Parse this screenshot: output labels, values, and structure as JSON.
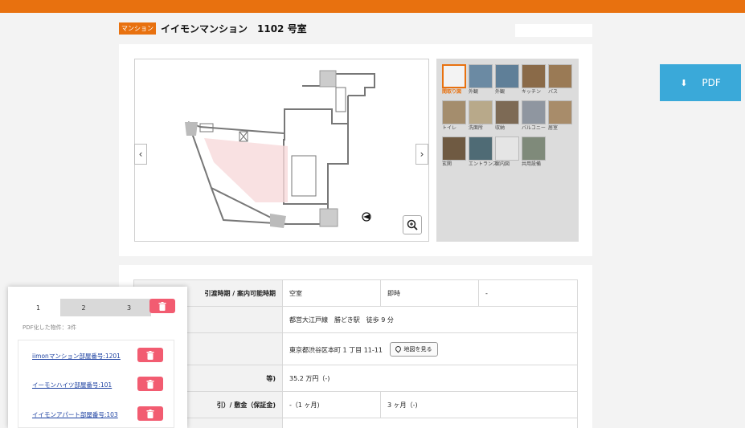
{
  "header": {
    "type_badge": "マンション",
    "title": "イイモンマンション　1102 号室"
  },
  "floorplan": {
    "prev_icon": "chevron-left-icon",
    "next_icon": "chevron-right-icon",
    "zoom_icon": "zoom-in-icon"
  },
  "thumbnails": [
    {
      "label": "間取り図",
      "color": "#f3f3f3"
    },
    {
      "label": "外観",
      "color": "#6b8aa3"
    },
    {
      "label": "外観",
      "color": "#5f7f98"
    },
    {
      "label": "キッチン",
      "color": "#8a6a48"
    },
    {
      "label": "バス",
      "color": "#9a7a55"
    },
    {
      "label": "トイレ",
      "color": "#a48d6d"
    },
    {
      "label": "洗面所",
      "color": "#b8a98a"
    },
    {
      "label": "収納",
      "color": "#7d6a55"
    },
    {
      "label": "バルコニー",
      "color": "#8f96a0"
    },
    {
      "label": "居室",
      "color": "#a88c6a"
    },
    {
      "label": "玄関",
      "color": "#6f5a42"
    },
    {
      "label": "エントランス",
      "color": "#4f6b75"
    },
    {
      "label": "案内図",
      "color": "#e5e5e5"
    },
    {
      "label": "共用設備",
      "color": "#7f8a7a"
    }
  ],
  "pdf_button": {
    "label": "PDF",
    "icon": "download-icon"
  },
  "info": {
    "rows": [
      {
        "header": "引渡時期 / 案内可能時期",
        "c1": "空室",
        "c2": "即時",
        "c3": "-"
      },
      {
        "header": "",
        "c1": "都営大江戸線　勝どき駅　徒歩 9 分"
      },
      {
        "header": "",
        "c1": "東京都渋谷区本町 1 丁目 11-11",
        "button": "地図を見る"
      },
      {
        "header": "等)",
        "c1": "35.2 万円（-)"
      },
      {
        "header": "引）/ 敷金（保証金)",
        "c1": "-（1 ヶ月)",
        "c2": "3 ヶ月（-)"
      }
    ]
  },
  "popup": {
    "tabs": [
      "1",
      "2",
      "3"
    ],
    "count_text": "PDF化した物件：3件",
    "items": [
      "iimonマンション部屋番号:1201",
      "イーモンハイツ部屋番号:101",
      "イイモンアパート部屋番号:103"
    ]
  }
}
